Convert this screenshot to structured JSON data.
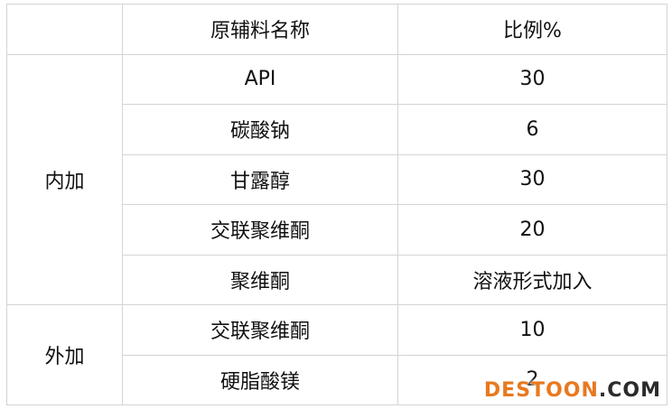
{
  "table": {
    "header": {
      "group": "",
      "name": "原辅料名称",
      "ratio": "比例%"
    },
    "groups": [
      {
        "label": "内加",
        "rows": [
          {
            "name": "API",
            "ratio": "30"
          },
          {
            "name": "碳酸钠",
            "ratio": "6"
          },
          {
            "name": "甘露醇",
            "ratio": "30"
          },
          {
            "name": "交联聚维酮",
            "ratio": "20"
          },
          {
            "name": "聚维酮",
            "ratio": "溶液形式加入"
          }
        ]
      },
      {
        "label": "外加",
        "rows": [
          {
            "name": "交联聚维酮",
            "ratio": "10"
          },
          {
            "name": "硬脂酸镁",
            "ratio": "2"
          }
        ]
      }
    ]
  },
  "watermark": {
    "part1": "DESTOON",
    "part2": ".COM"
  }
}
